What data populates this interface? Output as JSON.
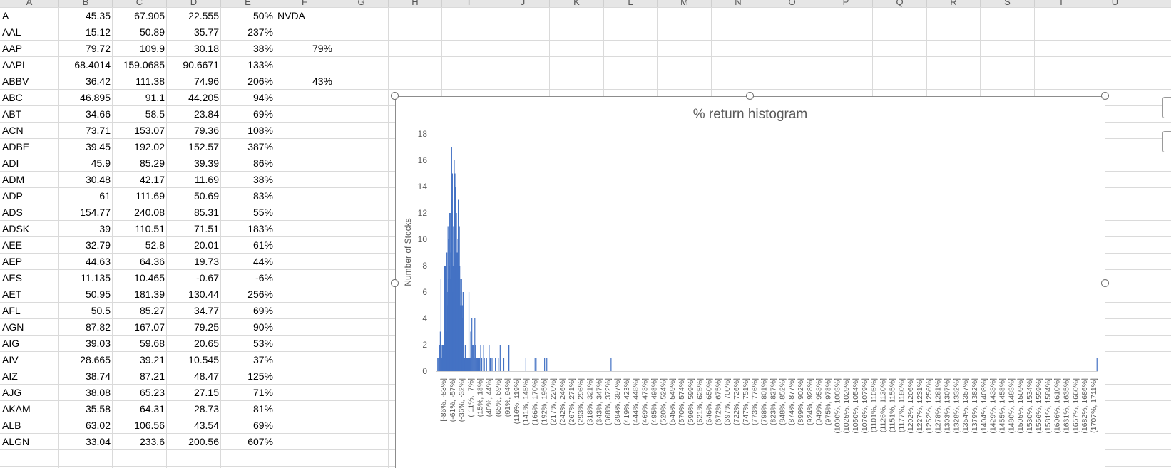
{
  "column_headers": [
    "A",
    "B",
    "C",
    "D",
    "E",
    "F",
    "G",
    "H",
    "I",
    "J",
    "K",
    "L",
    "M",
    "N",
    "O",
    "P",
    "Q",
    "R",
    "S",
    "T",
    "U"
  ],
  "rows": [
    [
      "A",
      "45.35",
      "67.905",
      "22.555",
      "50%",
      "NVDA"
    ],
    [
      "AAL",
      "15.12",
      "50.89",
      "35.77",
      "237%",
      ""
    ],
    [
      "AAP",
      "79.72",
      "109.9",
      "30.18",
      "38%",
      "79%"
    ],
    [
      "AAPL",
      "68.4014",
      "159.0685",
      "90.6671",
      "133%",
      ""
    ],
    [
      "ABBV",
      "36.42",
      "111.38",
      "74.96",
      "206%",
      "43%"
    ],
    [
      "ABC",
      "46.895",
      "91.1",
      "44.205",
      "94%",
      ""
    ],
    [
      "ABT",
      "34.66",
      "58.5",
      "23.84",
      "69%",
      ""
    ],
    [
      "ACN",
      "73.71",
      "153.07",
      "79.36",
      "108%",
      ""
    ],
    [
      "ADBE",
      "39.45",
      "192.02",
      "152.57",
      "387%",
      ""
    ],
    [
      "ADI",
      "45.9",
      "85.29",
      "39.39",
      "86%",
      ""
    ],
    [
      "ADM",
      "30.48",
      "42.17",
      "11.69",
      "38%",
      ""
    ],
    [
      "ADP",
      "61",
      "111.69",
      "50.69",
      "83%",
      ""
    ],
    [
      "ADS",
      "154.77",
      "240.08",
      "85.31",
      "55%",
      ""
    ],
    [
      "ADSK",
      "39",
      "110.51",
      "71.51",
      "183%",
      ""
    ],
    [
      "AEE",
      "32.79",
      "52.8",
      "20.01",
      "61%",
      ""
    ],
    [
      "AEP",
      "44.63",
      "64.36",
      "19.73",
      "44%",
      ""
    ],
    [
      "AES",
      "11.135",
      "10.465",
      "-0.67",
      "-6%",
      ""
    ],
    [
      "AET",
      "50.95",
      "181.39",
      "130.44",
      "256%",
      ""
    ],
    [
      "AFL",
      "50.5",
      "85.27",
      "34.77",
      "69%",
      ""
    ],
    [
      "AGN",
      "87.82",
      "167.07",
      "79.25",
      "90%",
      ""
    ],
    [
      "AIG",
      "39.03",
      "59.68",
      "20.65",
      "53%",
      ""
    ],
    [
      "AIV",
      "28.665",
      "39.21",
      "10.545",
      "37%",
      ""
    ],
    [
      "AIZ",
      "38.74",
      "87.21",
      "48.47",
      "125%",
      ""
    ],
    [
      "AJG",
      "38.08",
      "65.23",
      "27.15",
      "71%",
      ""
    ],
    [
      "AKAM",
      "35.58",
      "64.31",
      "28.73",
      "81%",
      ""
    ],
    [
      "ALB",
      "63.02",
      "106.56",
      "43.54",
      "69%",
      ""
    ],
    [
      "ALGN",
      "33.04",
      "233.6",
      "200.56",
      "607%",
      ""
    ]
  ],
  "chart_data": {
    "type": "bar",
    "title": "% return histogram",
    "xlabel": "",
    "ylabel": "Number of Stocks",
    "ylim": [
      0,
      18
    ],
    "yticks": [
      0,
      2,
      4,
      6,
      8,
      10,
      12,
      14,
      16,
      18
    ],
    "grid": false,
    "legend": "none",
    "bar_color": "#4472c4",
    "bin_start_pct": -86,
    "bin_width_pct": 1,
    "bin_count": 1798,
    "tick_labels": [
      "[-86%, -83%]",
      "(-61%, -57%]",
      "(-36%, -32%]",
      "(-11%, -7%]",
      "(15%, 18%]",
      "(40%, 44%]",
      "(65%, 69%]",
      "(91%, 94%]",
      "(116%, 119%]",
      "(141%, 145%]",
      "(166%, 170%]",
      "(192%, 195%]",
      "(217%, 220%]",
      "(242%, 246%]",
      "(267%, 271%]",
      "(293%, 296%]",
      "(318%, 321%]",
      "(343%, 347%]",
      "(368%, 372%]",
      "(394%, 397%]",
      "(419%, 423%]",
      "(444%, 448%]",
      "(469%, 473%]",
      "(495%, 498%]",
      "(520%, 524%]",
      "(545%, 549%]",
      "(570%, 574%]",
      "(596%, 599%]",
      "(621%, 625%]",
      "(646%, 650%]",
      "(672%, 675%]",
      "(697%, 700%]",
      "(722%, 726%]",
      "(747%, 751%]",
      "(773%, 776%]",
      "(798%, 801%]",
      "(823%, 827%]",
      "(848%, 852%]",
      "(874%, 877%]",
      "(899%, 902%]",
      "(924%, 928%]",
      "(949%, 953%]",
      "(975%, 978%]",
      "(1000%, 1003%]",
      "(1025%, 1029%]",
      "(1050%, 1054%]",
      "(1076%, 1079%]",
      "(1101%, 1105%]",
      "(1126%, 1130%]",
      "(1151%, 1155%]",
      "(1177%, 1180%]",
      "(1202%, 1206%]",
      "(1227%, 1231%]",
      "(1252%, 1256%]",
      "(1278%, 1281%]",
      "(1303%, 1307%]",
      "(1328%, 1332%]",
      "(1354%, 1357%]",
      "(1379%, 1382%]",
      "(1404%, 1408%]",
      "(1429%, 1433%]",
      "(1455%, 1458%]",
      "(1480%, 1483%]",
      "(1505%, 1509%]",
      "(1530%, 1534%]",
      "(1556%, 1559%]",
      "(1581%, 1584%]",
      "(1606%, 1610%]",
      "(1631%, 1635%]",
      "(1657%, 1660%]",
      "(1682%, 1686%]",
      "(1707%, 1711%]"
    ],
    "bars": [
      {
        "x": -85,
        "y": 1
      },
      {
        "x": -84,
        "y": 1
      },
      {
        "x": -80,
        "y": 2
      },
      {
        "x": -78,
        "y": 3
      },
      {
        "x": -76,
        "y": 7
      },
      {
        "x": -75,
        "y": 1
      },
      {
        "x": -73,
        "y": 2
      },
      {
        "x": -71,
        "y": 2
      },
      {
        "x": -70,
        "y": 2
      },
      {
        "x": -68,
        "y": 1
      },
      {
        "x": -66,
        "y": 8
      },
      {
        "x": -65,
        "y": 6
      },
      {
        "x": -64,
        "y": 8
      },
      {
        "x": -63,
        "y": 4
      },
      {
        "x": -62,
        "y": 7
      },
      {
        "x": -61,
        "y": 3
      },
      {
        "x": -60,
        "y": 9
      },
      {
        "x": -59,
        "y": 5
      },
      {
        "x": -58,
        "y": 6
      },
      {
        "x": -57,
        "y": 11
      },
      {
        "x": -56,
        "y": 7
      },
      {
        "x": -55,
        "y": 10
      },
      {
        "x": -54,
        "y": 11
      },
      {
        "x": -53,
        "y": 12
      },
      {
        "x": -52,
        "y": 8
      },
      {
        "x": -51,
        "y": 12
      },
      {
        "x": -50,
        "y": 7
      },
      {
        "x": -49,
        "y": 9
      },
      {
        "x": -48,
        "y": 6
      },
      {
        "x": -47,
        "y": 17
      },
      {
        "x": -46,
        "y": 13
      },
      {
        "x": -45,
        "y": 15
      },
      {
        "x": -44,
        "y": 8
      },
      {
        "x": -43,
        "y": 6
      },
      {
        "x": -42,
        "y": 11
      },
      {
        "x": -41,
        "y": 10
      },
      {
        "x": -40,
        "y": 16
      },
      {
        "x": -39,
        "y": 12
      },
      {
        "x": -38,
        "y": 15
      },
      {
        "x": -37,
        "y": 9
      },
      {
        "x": -36,
        "y": 14
      },
      {
        "x": -35,
        "y": 10
      },
      {
        "x": -34,
        "y": 12
      },
      {
        "x": -33,
        "y": 8
      },
      {
        "x": -32,
        "y": 9
      },
      {
        "x": -31,
        "y": 5
      },
      {
        "x": -30,
        "y": 10
      },
      {
        "x": -29,
        "y": 13
      },
      {
        "x": -28,
        "y": 8
      },
      {
        "x": -27,
        "y": 8
      },
      {
        "x": -26,
        "y": 11
      },
      {
        "x": -25,
        "y": 8
      },
      {
        "x": -24,
        "y": 7
      },
      {
        "x": -23,
        "y": 5
      },
      {
        "x": -22,
        "y": 5
      },
      {
        "x": -21,
        "y": 5
      },
      {
        "x": -20,
        "y": 7
      },
      {
        "x": -19,
        "y": 5
      },
      {
        "x": -18,
        "y": 5
      },
      {
        "x": -17,
        "y": 4
      },
      {
        "x": -16,
        "y": 6
      },
      {
        "x": -15,
        "y": 6
      },
      {
        "x": -14,
        "y": 2
      },
      {
        "x": -12,
        "y": 1
      },
      {
        "x": -11,
        "y": 1
      },
      {
        "x": -10,
        "y": 2
      },
      {
        "x": -9,
        "y": 1
      },
      {
        "x": -7,
        "y": 1
      },
      {
        "x": -6,
        "y": 1
      },
      {
        "x": -5,
        "y": 1
      },
      {
        "x": -4,
        "y": 1
      },
      {
        "x": -3,
        "y": 1
      },
      {
        "x": -2,
        "y": 1
      },
      {
        "x": 0,
        "y": 6
      },
      {
        "x": 2,
        "y": 1
      },
      {
        "x": 3,
        "y": 1
      },
      {
        "x": 5,
        "y": 3
      },
      {
        "x": 6,
        "y": 1
      },
      {
        "x": 8,
        "y": 4
      },
      {
        "x": 10,
        "y": 2
      },
      {
        "x": 12,
        "y": 2
      },
      {
        "x": 14,
        "y": 1
      },
      {
        "x": 16,
        "y": 4
      },
      {
        "x": 18,
        "y": 2
      },
      {
        "x": 20,
        "y": 1
      },
      {
        "x": 22,
        "y": 1
      },
      {
        "x": 24,
        "y": 1
      },
      {
        "x": 26,
        "y": 1
      },
      {
        "x": 29,
        "y": 1
      },
      {
        "x": 32,
        "y": 2
      },
      {
        "x": 35,
        "y": 1
      },
      {
        "x": 40,
        "y": 2
      },
      {
        "x": 42,
        "y": 1
      },
      {
        "x": 48,
        "y": 1
      },
      {
        "x": 55,
        "y": 2
      },
      {
        "x": 58,
        "y": 1
      },
      {
        "x": 63,
        "y": 1
      },
      {
        "x": 72,
        "y": 1
      },
      {
        "x": 80,
        "y": 1
      },
      {
        "x": 85,
        "y": 2
      },
      {
        "x": 95,
        "y": 1
      },
      {
        "x": 108,
        "y": 2
      },
      {
        "x": 109,
        "y": 2
      },
      {
        "x": 155,
        "y": 1
      },
      {
        "x": 180,
        "y": 1
      },
      {
        "x": 183,
        "y": 1
      },
      {
        "x": 206,
        "y": 1
      },
      {
        "x": 212,
        "y": 1
      },
      {
        "x": 387,
        "y": 1
      },
      {
        "x": 1710,
        "y": 1
      }
    ]
  }
}
